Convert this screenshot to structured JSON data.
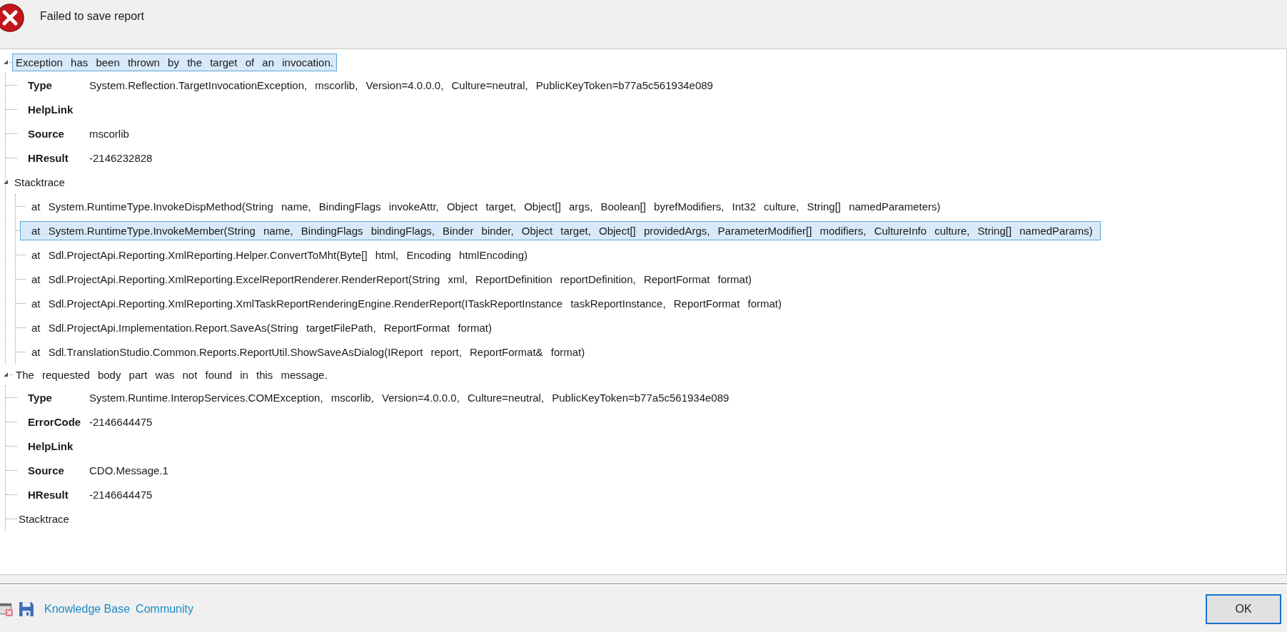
{
  "title": "Failed to save report",
  "exceptions": [
    {
      "message": "Exception has been thrown by the target of an invocation.",
      "expanded": true,
      "selected": true,
      "properties": [
        {
          "name": "Type",
          "value": "System.Reflection.TargetInvocationException,  mscorlib,  Version=4.0.0.0,  Culture=neutral,  PublicKeyToken=b77a5c561934e089"
        },
        {
          "name": "HelpLink"
        },
        {
          "name": "Source",
          "value": "mscorlib"
        },
        {
          "name": "HResult",
          "value": "-2146232828"
        }
      ],
      "stacktrace": {
        "label": "Stacktrace",
        "expanded": true,
        "frames": [
          {
            "text": "at  System.RuntimeType.InvokeDispMethod(String  name,  BindingFlags  invokeAttr,  Object  target,  Object[]  args,  Boolean[]  byrefModifiers,  Int32  culture,  String[]  namedParameters)",
            "selected": false
          },
          {
            "text": "at  System.RuntimeType.InvokeMember(String  name,  BindingFlags  bindingFlags,  Binder  binder,  Object  target,  Object[]  providedArgs,  ParameterModifier[]  modifiers,  CultureInfo  culture,  String[]  namedParams)",
            "selected": true
          },
          {
            "text": "at  Sdl.ProjectApi.Reporting.XmlReporting.Helper.ConvertToMht(Byte[]  html,  Encoding  htmlEncoding)",
            "selected": false
          },
          {
            "text": "at  Sdl.ProjectApi.Reporting.XmlReporting.ExcelReportRenderer.RenderReport(String  xml,  ReportDefinition  reportDefinition,  ReportFormat  format)",
            "selected": false
          },
          {
            "text": "at  Sdl.ProjectApi.Reporting.XmlReporting.XmlTaskReportRenderingEngine.RenderReport(ITaskReportInstance  taskReportInstance,  ReportFormat  format)",
            "selected": false
          },
          {
            "text": "at  Sdl.ProjectApi.Implementation.Report.SaveAs(String  targetFilePath,  ReportFormat  format)",
            "selected": false
          },
          {
            "text": "at  Sdl.TranslationStudio.Common.Reports.ReportUtil.ShowSaveAsDialog(IReport  report,  ReportFormat&  format)",
            "selected": false
          }
        ]
      }
    },
    {
      "message": "The requested body part was not found in this message.",
      "expanded": true,
      "selected": false,
      "properties": [
        {
          "name": "Type",
          "value": "System.Runtime.InteropServices.COMException,  mscorlib,  Version=4.0.0.0,  Culture=neutral,  PublicKeyToken=b77a5c561934e089"
        },
        {
          "name": "ErrorCode",
          "value": "-2146644475"
        },
        {
          "name": "HelpLink"
        },
        {
          "name": "Source",
          "value": "CDO.Message.1"
        },
        {
          "name": "HResult",
          "value": "-2146644475"
        }
      ],
      "stacktrace": {
        "label": "Stacktrace"
      }
    }
  ],
  "links": [
    "Knowledge Base",
    "Community"
  ],
  "ok_button": "OK"
}
